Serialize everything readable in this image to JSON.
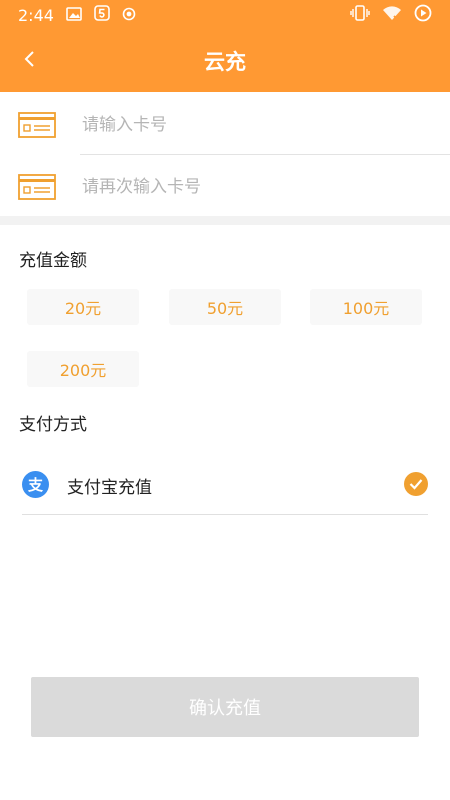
{
  "status_bar": {
    "time": "2:44",
    "icons": [
      "image-icon",
      "notification-5-icon",
      "record-icon",
      "vibrate-icon",
      "wifi-icon",
      "battery-icon"
    ]
  },
  "header": {
    "title": "云充",
    "back_icon": "chevron-left-icon",
    "background": "#ff9933"
  },
  "card_inputs": [
    {
      "placeholder": "请输入卡号",
      "value": "",
      "icon": "card-icon"
    },
    {
      "placeholder": "请再次输入卡号",
      "value": "",
      "icon": "card-icon"
    }
  ],
  "amount_section": {
    "title": "充值金额",
    "options": [
      "20元",
      "50元",
      "100元",
      "200元"
    ],
    "accent": "#f0a030"
  },
  "payment_section": {
    "title": "支付方式",
    "methods": [
      {
        "label": "支付宝充值",
        "icon_text": "支",
        "selected": true
      }
    ]
  },
  "confirm_button": {
    "label": "确认充值",
    "background": "#dadada"
  }
}
